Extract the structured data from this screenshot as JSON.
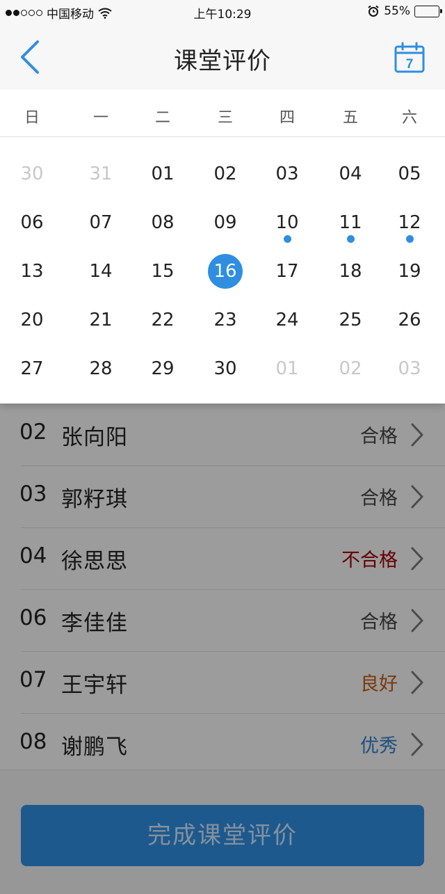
{
  "status": {
    "carrier": "中国移动",
    "time": "上午10:29",
    "battery": "55%",
    "battery_level": 0.55,
    "icons": [
      "signal-dots-icon",
      "wifi-icon",
      "alarm-icon",
      "battery-icon"
    ]
  },
  "nav": {
    "title": "课堂评价",
    "back_icon": "chevron-left-icon",
    "calendar_icon": "calendar-icon",
    "calendar_day": "7"
  },
  "calendar": {
    "weekdays": [
      "日",
      "一",
      "二",
      "三",
      "四",
      "五",
      "六"
    ],
    "weeks": [
      [
        {
          "d": "30",
          "muted": true
        },
        {
          "d": "31",
          "muted": true
        },
        {
          "d": "01"
        },
        {
          "d": "02"
        },
        {
          "d": "03"
        },
        {
          "d": "04"
        },
        {
          "d": "05"
        }
      ],
      [
        {
          "d": "06"
        },
        {
          "d": "07"
        },
        {
          "d": "08"
        },
        {
          "d": "09"
        },
        {
          "d": "10",
          "dot": true
        },
        {
          "d": "11",
          "dot": true
        },
        {
          "d": "12",
          "dot": true
        }
      ],
      [
        {
          "d": "13"
        },
        {
          "d": "14"
        },
        {
          "d": "15"
        },
        {
          "d": "16",
          "selected": true
        },
        {
          "d": "17"
        },
        {
          "d": "18"
        },
        {
          "d": "19"
        }
      ],
      [
        {
          "d": "20"
        },
        {
          "d": "21"
        },
        {
          "d": "22"
        },
        {
          "d": "23"
        },
        {
          "d": "24"
        },
        {
          "d": "25"
        },
        {
          "d": "26"
        }
      ],
      [
        {
          "d": "27"
        },
        {
          "d": "28"
        },
        {
          "d": "29"
        },
        {
          "d": "30"
        },
        {
          "d": "01",
          "muted": true
        },
        {
          "d": "02",
          "muted": true
        },
        {
          "d": "03",
          "muted": true
        }
      ]
    ],
    "accent": "#2f8ee0"
  },
  "students": [
    {
      "num": "02",
      "name": "张向阳",
      "grade": "合格",
      "color": "#444444"
    },
    {
      "num": "03",
      "name": "郭籽琪",
      "grade": "合格",
      "color": "#444444"
    },
    {
      "num": "04",
      "name": "徐思思",
      "grade": "不合格",
      "color": "#a00000"
    },
    {
      "num": "06",
      "name": "李佳佳",
      "grade": "合格",
      "color": "#444444"
    },
    {
      "num": "07",
      "name": "王宇轩",
      "grade": "良好",
      "color": "#c25a17"
    },
    {
      "num": "08",
      "name": "谢鹏飞",
      "grade": "优秀",
      "color": "#2f7fc8"
    }
  ],
  "footer": {
    "done_label": "完成课堂评价"
  }
}
